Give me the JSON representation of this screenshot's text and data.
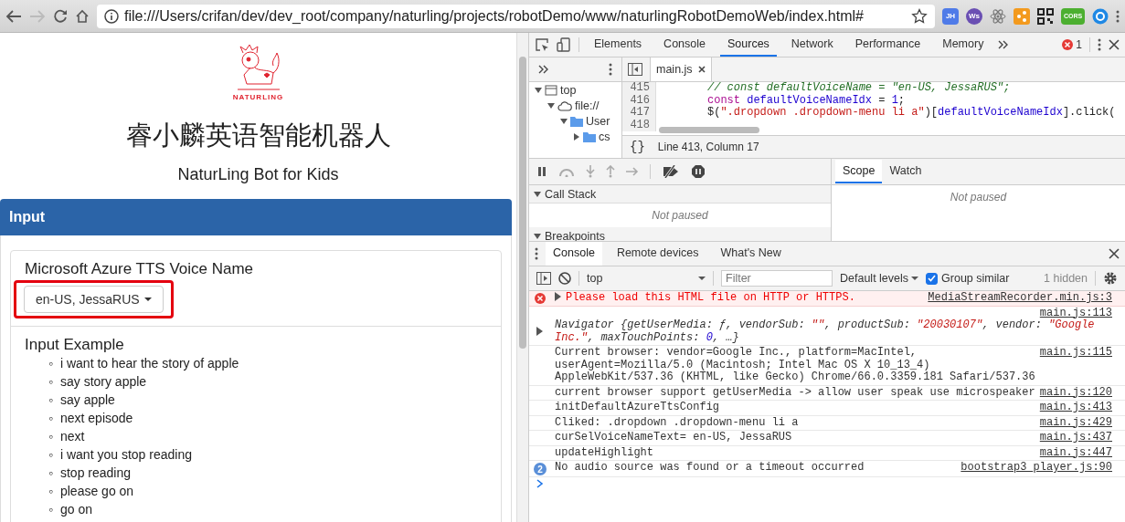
{
  "browser": {
    "url": "file:///Users/crifan/dev/dev_root/company/naturling/projects/robotDemo/www/naturlingRobotDemoWeb/index.html#",
    "extensions": [
      {
        "kind": "jh",
        "label": "JH"
      },
      {
        "kind": "ws",
        "label": "Ws"
      },
      {
        "kind": "atom"
      },
      {
        "kind": "share"
      },
      {
        "kind": "qr"
      },
      {
        "kind": "cors",
        "label": "CORS"
      },
      {
        "kind": "globe"
      }
    ]
  },
  "page": {
    "logo_text": "NATURLING",
    "title": "睿小麟英语智能机器人",
    "subtitle": "NaturLing Bot for Kids",
    "panel_title": "Input",
    "voice_label": "Microsoft Azure TTS Voice Name",
    "voice_value": "en-US, JessaRUS",
    "voice_highlighted": true,
    "examples_title": "Input Example",
    "bullet": "◦",
    "examples": [
      "i want to hear the story of apple",
      "say story apple",
      "say apple",
      "next episode",
      "next",
      "i want you stop reading",
      "stop reading",
      "please go on",
      "go on"
    ]
  },
  "devtools": {
    "tabs": [
      {
        "label": "Elements",
        "selected": false
      },
      {
        "label": "Console",
        "selected": false
      },
      {
        "label": "Sources",
        "selected": true
      },
      {
        "label": "Network",
        "selected": false
      },
      {
        "label": "Performance",
        "selected": false
      },
      {
        "label": "Memory",
        "selected": false
      }
    ],
    "error_count": "1",
    "navigator": [
      {
        "label": "top",
        "kind": "frame",
        "expanded": true,
        "children": [
          {
            "label": "file://",
            "kind": "cloud",
            "expanded": true,
            "children": [
              {
                "label": "User",
                "kind": "folder",
                "expanded": true,
                "children": [
                  {
                    "label": "cs",
                    "kind": "folder",
                    "expanded": false
                  }
                ]
              }
            ]
          }
        ]
      }
    ],
    "file_tab": "main.js",
    "code": [
      {
        "number": "415",
        "tokens": [
          {
            "kind": "comment",
            "text": "// const defaultVoiceName = \"en-US, JessaRUS\";"
          }
        ]
      },
      {
        "number": "416",
        "tokens": [
          {
            "kind": "keyword",
            "text": "const"
          },
          {
            "kind": "variable",
            "text": "defaultVoiceNameIdx"
          },
          {
            "kind": "plain",
            "text": " = "
          },
          {
            "kind": "number",
            "text": "1"
          },
          {
            "kind": "plain",
            "text": ";"
          }
        ]
      },
      {
        "number": "417",
        "tokens": [
          {
            "kind": "plain",
            "text": "$("
          },
          {
            "kind": "string",
            "text": "\".dropdown .dropdown-menu li a\""
          },
          {
            "kind": "plain",
            "text": ")["
          },
          {
            "kind": "variable",
            "text": "defaultVoiceNameIdx"
          },
          {
            "kind": "plain",
            "text": "].click("
          }
        ]
      },
      {
        "number": "418"
      }
    ],
    "pretty_print": "{}",
    "cursor": "Line 413, Column 17",
    "call_stack_title": "Call Stack",
    "call_stack_status": "Not paused",
    "breakpoints_title": "Breakpoints",
    "sidebar_tabs": [
      {
        "label": "Scope",
        "selected": true
      },
      {
        "label": "Watch",
        "selected": false
      }
    ],
    "scope_status": "Not paused",
    "drawer_tabs": [
      {
        "label": "Console",
        "selected": true
      },
      {
        "label": "Remote devices",
        "selected": false
      },
      {
        "label": "What's New",
        "selected": false
      }
    ],
    "context": "top",
    "filter_placeholder": "Filter",
    "levels": "Default levels",
    "group_similar": {
      "label": "Group similar",
      "checked": true
    },
    "hidden": "1 hidden",
    "messages": [
      {
        "kind": "error",
        "source": "MediaStreamRecorder.min.js:3",
        "segments": [
          {
            "kind": "plain",
            "text": "Please load this HTML file on HTTP or HTTPS."
          }
        ]
      },
      {
        "kind": "object",
        "source": "main.js:113",
        "segments": [
          {
            "kind": "plain",
            "text": "Navigator {getUserMedia: ƒ, vendorSub: "
          },
          {
            "kind": "string",
            "text": "\"\""
          },
          {
            "kind": "plain",
            "text": ", productSub: "
          },
          {
            "kind": "string",
            "text": "\"20030107\""
          },
          {
            "kind": "plain",
            "text": ", vendor: "
          },
          {
            "kind": "string",
            "text": "\"Google Inc.\""
          },
          {
            "kind": "plain",
            "text": ", maxTouchPoints: "
          },
          {
            "kind": "number",
            "text": "0"
          },
          {
            "kind": "plain",
            "text": ", …}"
          }
        ]
      },
      {
        "kind": "log",
        "source": "main.js:115",
        "segments": [
          {
            "kind": "plain",
            "text": "Current browser: vendor=Google Inc., platform=MacIntel, userAgent=Mozilla/5.0 (Macintosh; Intel Mac OS X 10_13_4) AppleWebKit/537.36 (KHTML, like Gecko) Chrome/66.0.3359.181 Safari/537.36"
          }
        ]
      },
      {
        "kind": "log",
        "source": "main.js:120",
        "segments": [
          {
            "kind": "plain",
            "text": "current browser support getUserMedia -> allow user speak use microspeaker"
          }
        ]
      },
      {
        "kind": "log",
        "source": "main.js:413",
        "segments": [
          {
            "kind": "plain",
            "text": "initDefaultAzureTtsConfig"
          }
        ]
      },
      {
        "kind": "log",
        "source": "main.js:429",
        "segments": [
          {
            "kind": "plain",
            "text": "Cliked: .dropdown .dropdown-menu li a"
          }
        ]
      },
      {
        "kind": "log",
        "source": "main.js:437",
        "segments": [
          {
            "kind": "plain",
            "text": "curSelVoiceNameText= en-US, JessaRUS"
          }
        ]
      },
      {
        "kind": "log",
        "source": "main.js:447",
        "segments": [
          {
            "kind": "plain",
            "text": "updateHighlight"
          }
        ]
      },
      {
        "kind": "info",
        "count": "2",
        "source": "bootstrap3_player.js:90",
        "segments": [
          {
            "kind": "plain",
            "text": "No audio source was found or a timeout occurred"
          }
        ]
      }
    ]
  }
}
